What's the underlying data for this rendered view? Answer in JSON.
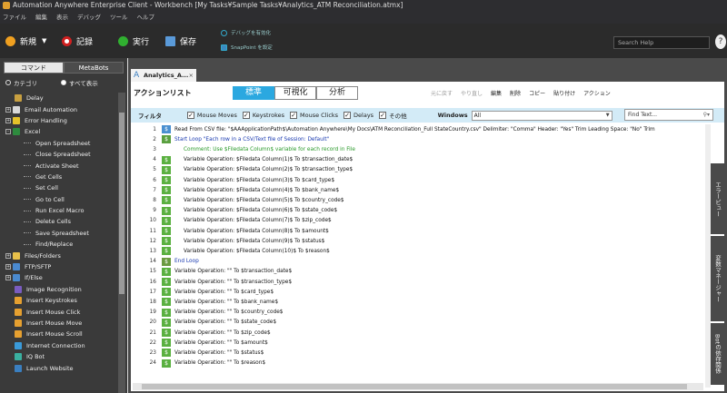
{
  "window": {
    "title": "Automation Anywhere Enterprise Client - Workbench [My Tasks¥Sample Tasks¥Analytics_ATM Reconciliation.atmx]"
  },
  "menu": [
    "ファイル",
    "編集",
    "表示",
    "デバッグ",
    "ツール",
    "ヘルプ"
  ],
  "toolbar": {
    "new": "新規",
    "record": "記録",
    "run": "実行",
    "save": "保存",
    "debug": "デバッグを有効化",
    "snappoint": "SnapPoint を設定",
    "search_help": "Search Help",
    "help": "?"
  },
  "left": {
    "tab_commands": "コマンド",
    "tab_metabots": "MetaBots",
    "radio_category": "カテゴリ",
    "radio_all": "すべて表示",
    "tree": [
      {
        "label": "Delay",
        "indent": 1,
        "exp": "",
        "icon": "#c8a040"
      },
      {
        "label": "Email Automation",
        "indent": 0,
        "exp": "+",
        "icon": "#d9d9d9"
      },
      {
        "label": "Error Handling",
        "indent": 0,
        "exp": "+",
        "icon": "#e6c22a"
      },
      {
        "label": "Excel",
        "indent": 0,
        "exp": "-",
        "icon": "#2e8b3e"
      },
      {
        "label": "Open Spreadsheet",
        "indent": 2,
        "exp": "",
        "icon": ""
      },
      {
        "label": "Close Spreadsheet",
        "indent": 2,
        "exp": "",
        "icon": ""
      },
      {
        "label": "Activate Sheet",
        "indent": 2,
        "exp": "",
        "icon": ""
      },
      {
        "label": "Get Cells",
        "indent": 2,
        "exp": "",
        "icon": ""
      },
      {
        "label": "Set Cell",
        "indent": 2,
        "exp": "",
        "icon": ""
      },
      {
        "label": "Go to Cell",
        "indent": 2,
        "exp": "",
        "icon": ""
      },
      {
        "label": "Run Excel Macro",
        "indent": 2,
        "exp": "",
        "icon": ""
      },
      {
        "label": "Delete Cells",
        "indent": 2,
        "exp": "",
        "icon": ""
      },
      {
        "label": "Save Spreadsheet",
        "indent": 2,
        "exp": "",
        "icon": ""
      },
      {
        "label": "Find/Replace",
        "indent": 2,
        "exp": "",
        "icon": ""
      },
      {
        "label": "Files/Folders",
        "indent": 0,
        "exp": "+",
        "icon": "#e8c04a"
      },
      {
        "label": "FTP/SFTP",
        "indent": 0,
        "exp": "+",
        "icon": "#4a8ad0"
      },
      {
        "label": "If/Else",
        "indent": 0,
        "exp": "+",
        "icon": "#4a8ad0"
      },
      {
        "label": "Image Recognition",
        "indent": 1,
        "exp": "",
        "icon": "#7a5cc0"
      },
      {
        "label": "Insert Keystrokes",
        "indent": 1,
        "exp": "",
        "icon": "#e6a030"
      },
      {
        "label": "Insert Mouse Click",
        "indent": 1,
        "exp": "",
        "icon": "#e6a030"
      },
      {
        "label": "Insert Mouse Move",
        "indent": 1,
        "exp": "",
        "icon": "#e6a030"
      },
      {
        "label": "Insert Mouse Scroll",
        "indent": 1,
        "exp": "",
        "icon": "#e6a030"
      },
      {
        "label": "Internet Connection",
        "indent": 1,
        "exp": "",
        "icon": "#3a9ad9"
      },
      {
        "label": "IQ Bot",
        "indent": 1,
        "exp": "",
        "icon": "#3ab0a0"
      },
      {
        "label": "Launch Website",
        "indent": 1,
        "exp": "",
        "icon": "#3a7fc0"
      }
    ]
  },
  "doc": {
    "tab": "Analytics_A...",
    "title": "アクションリスト",
    "views": [
      "標準",
      "可視化",
      "分析"
    ],
    "actions": [
      {
        "label": "元に戻す",
        "dim": true
      },
      {
        "label": "やり直し",
        "dim": true
      },
      {
        "label": "編集",
        "dim": false
      },
      {
        "label": "削除",
        "dim": false
      },
      {
        "label": "コピー",
        "dim": false
      },
      {
        "label": "貼り付け",
        "dim": false
      },
      {
        "label": "アクション",
        "dim": false
      }
    ],
    "filter": {
      "label": "フィルタ",
      "checks": [
        "Mouse Moves",
        "Keystrokes",
        "Mouse Clicks",
        "Delays",
        "その他"
      ],
      "windows_label": "Windows",
      "windows_value": "All",
      "find_placeholder": "Find Text..."
    },
    "right_tabs": [
      "エラービュー",
      "変数マネージャー",
      "Botの依存関係"
    ],
    "lines": [
      {
        "n": "1",
        "text": "Read From CSV file: \"$AAApplicationPath$\\Automation Anywhere\\My Docs\\ATM Reconciliation_Full StateCountry.csv\" Delimiter: \"Comma\" Header: \"Yes\" Trim Leading Space: \"No\" Trim",
        "color": "#111",
        "indent": 0,
        "icon": "#4a90d0"
      },
      {
        "n": "2",
        "text": "Start Loop \"Each row in a CSV/Text file of Session: Default\"",
        "color": "#1a3ab0",
        "indent": 0,
        "icon": "#5aa040"
      },
      {
        "n": "3",
        "text": "Comment: Use $Filedata Column$ variable for each record in File",
        "color": "#2a9a2a",
        "indent": 1,
        "icon": ""
      },
      {
        "n": "4",
        "text": "Variable Operation: $Filedata Column(1)$ To $transaction_date$",
        "color": "#111",
        "indent": 1,
        "icon": "#5ab040"
      },
      {
        "n": "5",
        "text": "Variable Operation: $Filedata Column(2)$ To $transaction_type$",
        "color": "#111",
        "indent": 1,
        "icon": "#5ab040"
      },
      {
        "n": "6",
        "text": "Variable Operation: $Filedata Column(3)$ To $card_type$",
        "color": "#111",
        "indent": 1,
        "icon": "#5ab040"
      },
      {
        "n": "7",
        "text": "Variable Operation: $Filedata Column(4)$ To $bank_name$",
        "color": "#111",
        "indent": 1,
        "icon": "#5ab040"
      },
      {
        "n": "8",
        "text": "Variable Operation: $Filedata Column(5)$ To $country_code$",
        "color": "#111",
        "indent": 1,
        "icon": "#5ab040"
      },
      {
        "n": "9",
        "text": "Variable Operation: $Filedata Column(6)$ To $state_code$",
        "color": "#111",
        "indent": 1,
        "icon": "#5ab040"
      },
      {
        "n": "10",
        "text": "Variable Operation: $Filedata Column(7)$ To $zip_code$",
        "color": "#111",
        "indent": 1,
        "icon": "#5ab040"
      },
      {
        "n": "11",
        "text": "Variable Operation: $Filedata Column(8)$ To $amount$",
        "color": "#111",
        "indent": 1,
        "icon": "#5ab040"
      },
      {
        "n": "12",
        "text": "Variable Operation: $Filedata Column(9)$ To $status$",
        "color": "#111",
        "indent": 1,
        "icon": "#5ab040"
      },
      {
        "n": "13",
        "text": "Variable Operation: $Filedata Column(10)$ To $reason$",
        "color": "#111",
        "indent": 1,
        "icon": "#5ab040"
      },
      {
        "n": "14",
        "text": "End Loop",
        "color": "#1a3ab0",
        "indent": 0,
        "icon": "#6a9a40"
      },
      {
        "n": "15",
        "text": "Variable Operation: \"\" To $transaction_date$",
        "color": "#111",
        "indent": 0,
        "icon": "#5ab040"
      },
      {
        "n": "16",
        "text": "Variable Operation: \"\" To $transaction_type$",
        "color": "#111",
        "indent": 0,
        "icon": "#5ab040"
      },
      {
        "n": "17",
        "text": "Variable Operation: \"\" To $card_type$",
        "color": "#111",
        "indent": 0,
        "icon": "#5ab040"
      },
      {
        "n": "18",
        "text": "Variable Operation: \"\" To $bank_name$",
        "color": "#111",
        "indent": 0,
        "icon": "#5ab040"
      },
      {
        "n": "19",
        "text": "Variable Operation: \"\" To $country_code$",
        "color": "#111",
        "indent": 0,
        "icon": "#5ab040"
      },
      {
        "n": "20",
        "text": "Variable Operation: \"\" To $state_code$",
        "color": "#111",
        "indent": 0,
        "icon": "#5ab040"
      },
      {
        "n": "21",
        "text": "Variable Operation: \"\" To $zip_code$",
        "color": "#111",
        "indent": 0,
        "icon": "#5ab040"
      },
      {
        "n": "22",
        "text": "Variable Operation: \"\" To $amount$",
        "color": "#111",
        "indent": 0,
        "icon": "#5ab040"
      },
      {
        "n": "23",
        "text": "Variable Operation: \"\" To $status$",
        "color": "#111",
        "indent": 0,
        "icon": "#5ab040"
      },
      {
        "n": "24",
        "text": "Variable Operation: \"\" To $reason$",
        "color": "#111",
        "indent": 0,
        "icon": "#5ab040"
      }
    ]
  }
}
